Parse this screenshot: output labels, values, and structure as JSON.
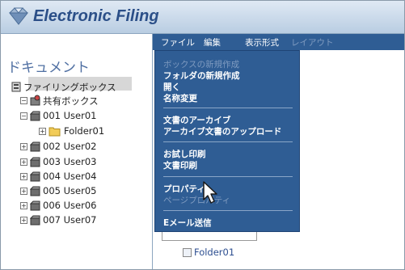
{
  "header": {
    "title": "Electronic Filing",
    "logo_icon": "gem-logo-icon"
  },
  "menubar": {
    "file": "ファイル",
    "edit": "編集",
    "view": "表示形式",
    "layout": "レイアウト"
  },
  "sidebar": {
    "title": "ドキュメント",
    "root": "ファイリングボックス",
    "shared": "共有ボックス",
    "boxes": [
      "001 User01",
      "002 User02",
      "003 User03",
      "004 User04",
      "005 User05",
      "006 User06",
      "007 User07"
    ],
    "subfolder": "Folder01"
  },
  "dropdown": {
    "new_box": "ボックスの新規作成",
    "new_folder": "フォルダの新規作成",
    "open": "開く",
    "rename": "名称変更",
    "archive": "文書のアーカイブ",
    "upload_archive": "アーカイブ文書のアップロード",
    "test_print": "お試し印刷",
    "print": "文書印刷",
    "properties": "プロパティ",
    "page_properties": "ページプロパティ",
    "email": "Eメール送信"
  },
  "content": {
    "folder": "Folder01"
  },
  "colors": {
    "menu_bg": "#2f5d94",
    "title": "#2b4f88",
    "header_bg": "#c9d9ea",
    "link": "#2c4e90"
  }
}
